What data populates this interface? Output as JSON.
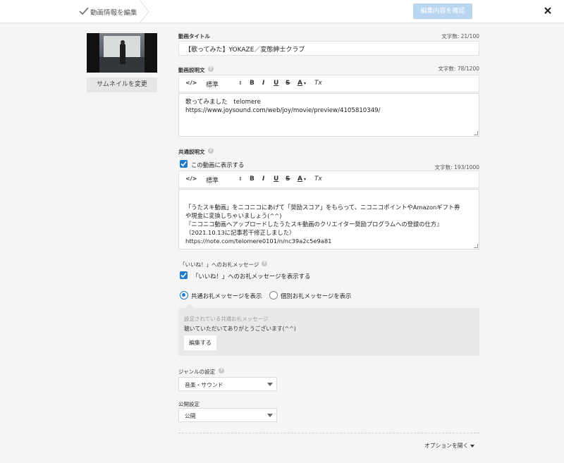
{
  "header": {
    "breadcrumb_label": "動画情報を編集",
    "confirm_button": "編集内容を確認",
    "close_icon": "close-icon",
    "check_icon": "check-icon"
  },
  "thumbnail": {
    "change_button": "サムネイルを変更"
  },
  "title": {
    "label": "動画タイトル",
    "count": "文字数: 21/100",
    "value": "【歌ってみた】YOKAZE／変態紳士クラブ"
  },
  "description": {
    "label": "動画説明文",
    "count": "文字数: 78/1200",
    "toolbar": {
      "source": "</>",
      "style": "標準",
      "bold": "B",
      "italic": "I",
      "underline": "U",
      "strike": "S",
      "color": "A",
      "clear": "Tx"
    },
    "lines": [
      "歌ってみました　telomere",
      "https://www.joysound.com/web/joy/movie/preview/4105810349/"
    ]
  },
  "common_description": {
    "label": "共通説明文",
    "checkbox_label": "この動画に表示する",
    "count": "文字数: 193/1000",
    "toolbar": {
      "source": "</>",
      "style": "標準",
      "bold": "B",
      "italic": "I",
      "underline": "U",
      "strike": "S",
      "color": "A",
      "clear": "Tx"
    },
    "lines": [
      "「うたスキ動画」をニコニコにあげて「奨励スコア」をもらって、ニコニコポイントやAmazonギフト券",
      "や現金に変換しちゃいましょう(^^)",
      "『ニコニコ動画へアップロードしたうたスキ動画のクリエイター奨励プログラムへの登録の仕方』",
      "（2021.10.13に記事若干修正しました）",
      "https://note.com/telomere0101/n/nc39a2c5e9a81"
    ]
  },
  "thanks": {
    "label": "「いいね！」へのお礼メッセージ",
    "checkbox_label": "「いいね！」へのお礼メッセージを表示する",
    "radio_common": "共通お礼メッセージを表示",
    "radio_individual": "個別お礼メッセージを表示",
    "selected": "common",
    "box_caption": "設定されている共通お礼メッセージ",
    "box_message": "聴いていただいてありがとうございます(^^)",
    "edit_button": "編集する"
  },
  "genre": {
    "label": "ジャンルの設定",
    "value": "音楽・サウンド"
  },
  "publish": {
    "label": "公開設定",
    "value": "公開"
  },
  "options_link": "オプションを開く",
  "colors": {
    "accent": "#1e7ccf",
    "confirm_disabled": "#b8d6f0",
    "background": "#f5f5f5"
  }
}
